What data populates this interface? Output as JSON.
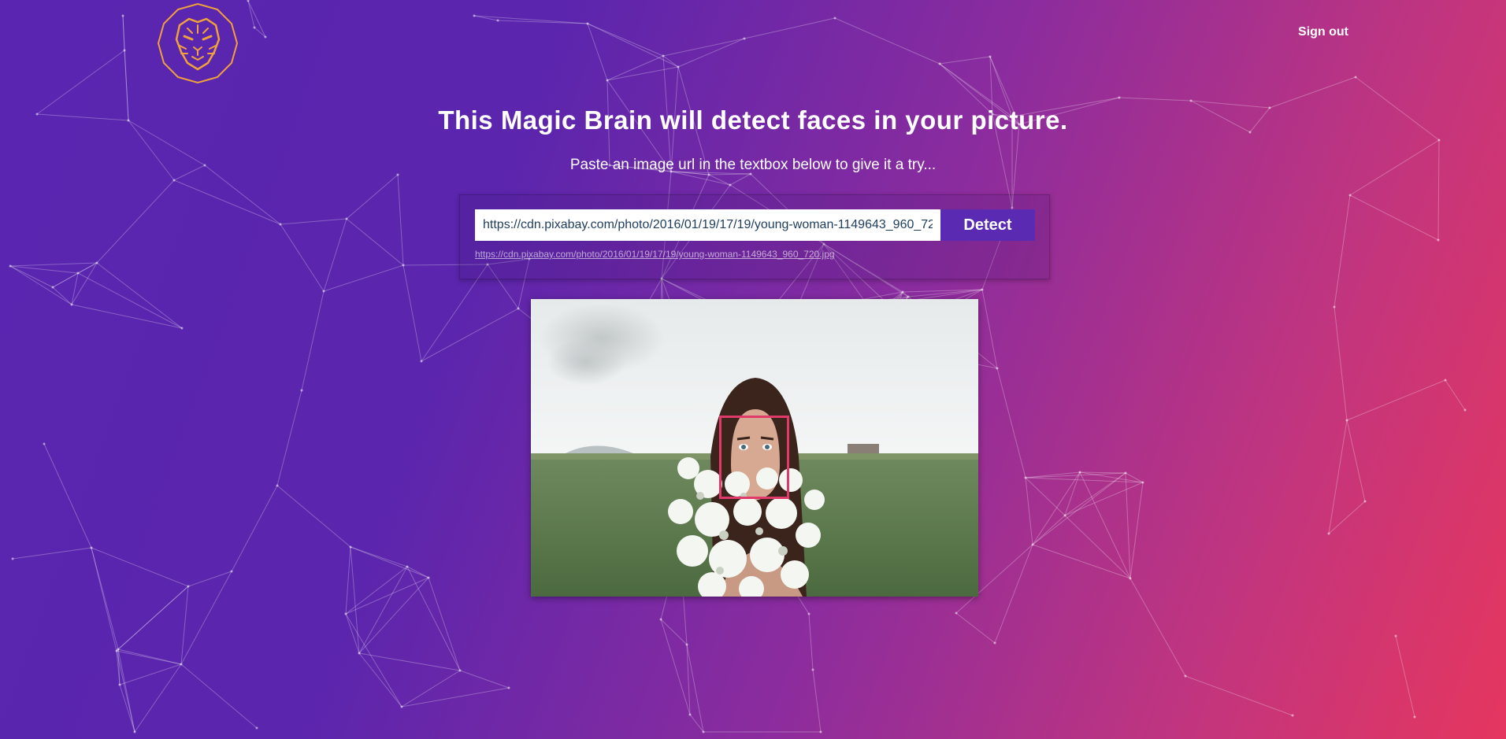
{
  "header": {
    "logo_icon": "tiger-head-icon",
    "sign_out_label": "Sign out"
  },
  "main": {
    "title": "This Magic Brain will detect faces in your picture.",
    "subtitle": "Paste an image url in the textbox below to give it a try...",
    "form": {
      "url_value": "https://cdn.pixabay.com/photo/2016/01/19/17/19/young-woman-1149643_960_720.jpg",
      "detect_label": "Detect",
      "url_echo": "https://cdn.pixabay.com/photo/2016/01/19/17/19/young-woman-1149643_960_720.jpg"
    },
    "result": {
      "image_description_icon": "photo-woman-flowers-field",
      "face_box_color": "#e03a6a"
    }
  },
  "colors": {
    "gradient_start": "#5a25b0",
    "gradient_end": "#e5365f",
    "accent": "#5b2ab3",
    "logo": "#f0a23a"
  }
}
